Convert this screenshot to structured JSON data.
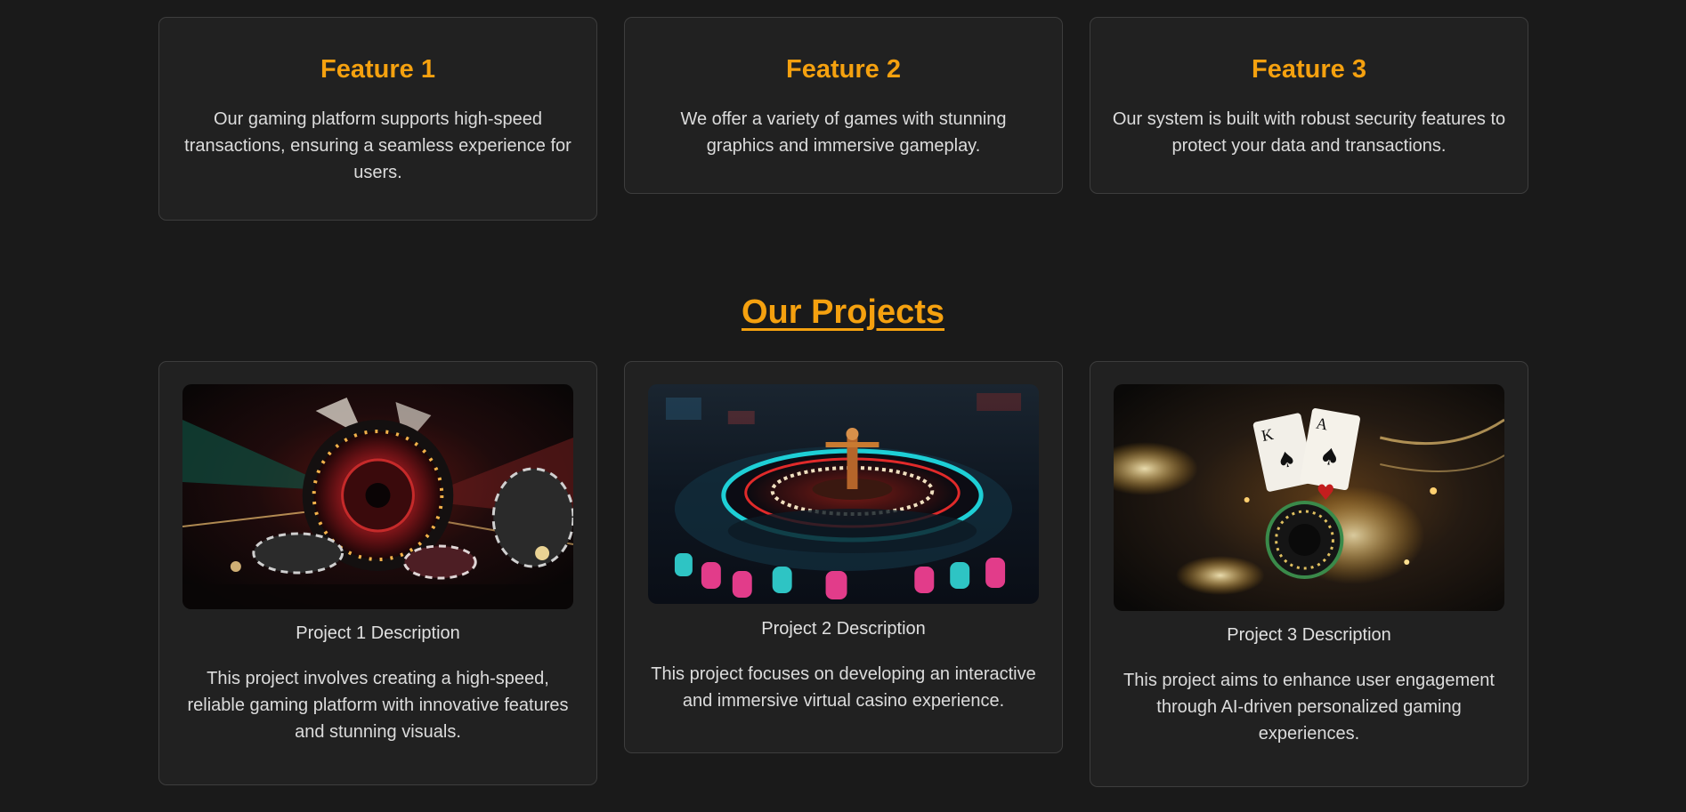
{
  "features": [
    {
      "title": "Feature 1",
      "text": "Our gaming platform supports high-speed transactions, ensuring a seamless experience for users."
    },
    {
      "title": "Feature 2",
      "text": "We offer a variety of games with stunning graphics and immersive gameplay."
    },
    {
      "title": "Feature 3",
      "text": "Our system is built with robust security features to protect your data and transactions."
    }
  ],
  "projects_section": {
    "heading": "Our Projects",
    "items": [
      {
        "title": "Project 1 Description",
        "text": "This project involves creating a high-speed, reliable gaming platform with innovative features and stunning visuals.",
        "image_icon": "casino-wheel-chips-image"
      },
      {
        "title": "Project 2 Description",
        "text": "This project focuses on developing an interactive and immersive virtual casino experience.",
        "image_icon": "roulette-wheel-image"
      },
      {
        "title": "Project 3 Description",
        "text": "This project aims to enhance user engagement through AI-driven personalized gaming experiences.",
        "image_icon": "playing-cards-chip-image"
      }
    ]
  },
  "colors": {
    "accent": "#f5a10f",
    "background": "#1a1a1a",
    "card": "#212121",
    "border": "#3d3d3d"
  }
}
